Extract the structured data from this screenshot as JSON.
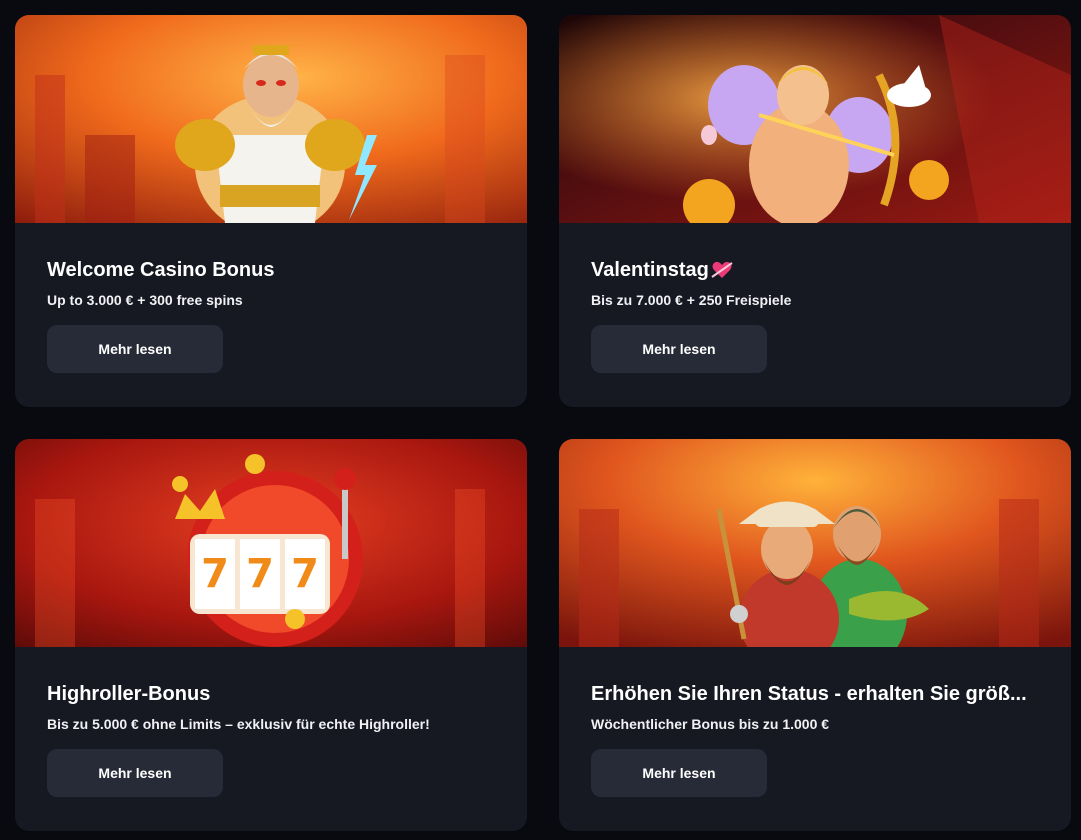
{
  "cards": [
    {
      "title": "Welcome Casino Bonus",
      "subtitle": "Up to 3.000 € + 300 free spins",
      "button": "Mehr lesen",
      "image": "zeus-god-character-illustration"
    },
    {
      "title": "Valentinstag",
      "title_icon": "heart-arrow-icon",
      "subtitle": "Bis zu 7.000 € + 250 Freispiele",
      "button": "Mehr lesen",
      "image": "cupid-character-illustration"
    },
    {
      "title": "Highroller-Bonus",
      "subtitle": "Bis zu 5.000 € ohne Limits – exklusiv für echte Highroller!",
      "button": "Mehr lesen",
      "image": "slot-machine-777-illustration"
    },
    {
      "title": "Erhöhen Sie Ihren Status - erhalten Sie größ...",
      "subtitle": "Wöchentlicher Bonus bis zu 1.000 €",
      "button": "Mehr lesen",
      "image": "fishermen-characters-illustration"
    }
  ],
  "colors": {
    "page_background": "#080a10",
    "card_background": "#161922",
    "button_background": "#272b37",
    "text": "#ffffff"
  }
}
